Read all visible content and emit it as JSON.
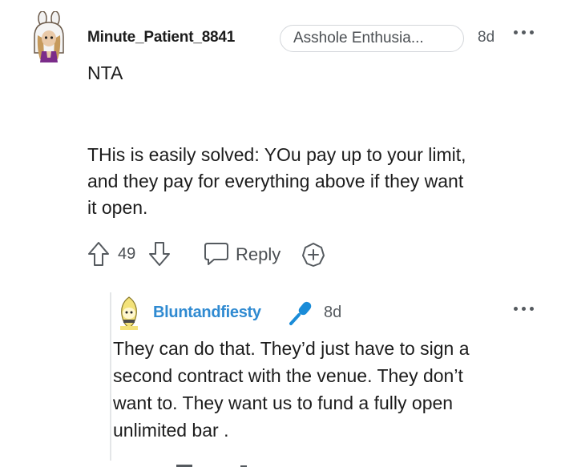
{
  "comment": {
    "username": "Minute_Patient_8841",
    "flair": "Asshole Enthusia...",
    "time": "8d",
    "body": [
      "NTA",
      "THis is easily solved: YOu pay up to your limit,",
      "and they pay for everything above if they want",
      "it open."
    ],
    "score": "49",
    "reply_label": "Reply",
    "icons": {
      "avatar": "avatar-bunny-hood",
      "more": "more-dots-icon",
      "upvote": "upvote-arrow-icon",
      "downvote": "downvote-arrow-icon",
      "reply": "chat-bubble-icon",
      "award": "award-plus-icon"
    }
  },
  "reply": {
    "username": "Bluntandfiesty",
    "time": "8d",
    "badge_icon": "microphone-icon",
    "body": [
      "They can do that. They’d just have to sign a",
      "second contract with the venue. They don’t",
      "want to. They want us to fund a fully open",
      "unlimited bar ."
    ]
  },
  "colors": {
    "text": "#1c1c1c",
    "muted": "#555a5f",
    "accent_username": "#2f8ad1",
    "mic_badge": "#1a8cd8",
    "flair_border": "#d3d6da",
    "thread_line": "#e4e6e8"
  }
}
